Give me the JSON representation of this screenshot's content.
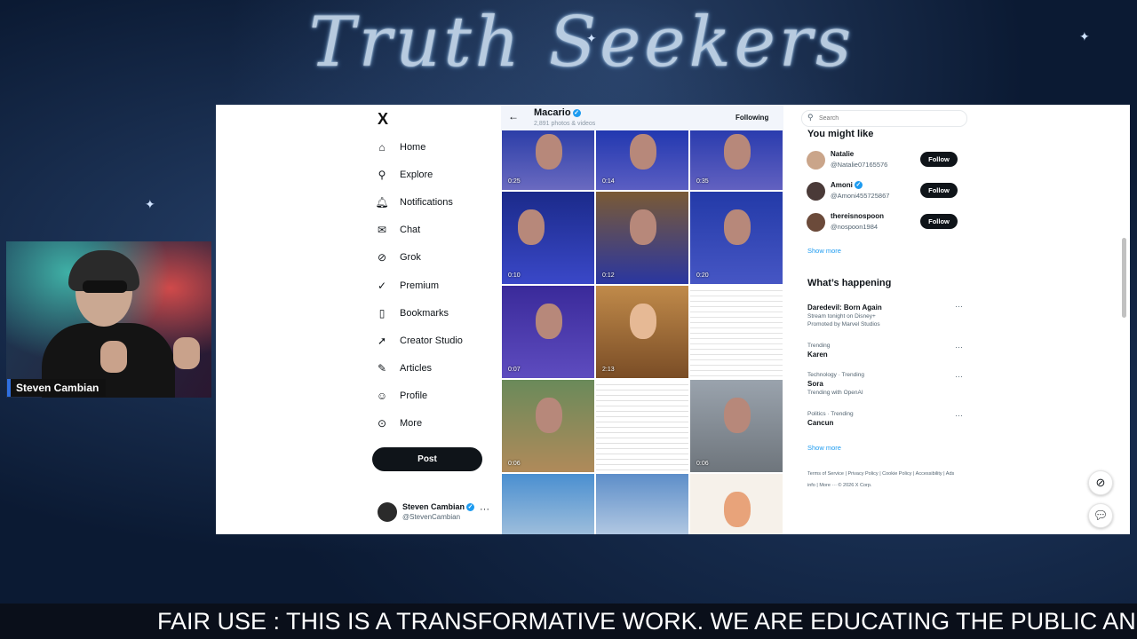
{
  "banner": {
    "title": "Truth Seekers"
  },
  "webcam": {
    "name": "Steven Cambian"
  },
  "ticker": {
    "text": "FAIR USE : THIS IS A TRANSFORMATIVE WORK. WE ARE EDUCATING THE PUBLIC AND C"
  },
  "x": {
    "logo": "X",
    "nav": [
      {
        "label": "Home",
        "icon": "home-icon"
      },
      {
        "label": "Explore",
        "icon": "search-icon"
      },
      {
        "label": "Notifications",
        "icon": "bell-icon"
      },
      {
        "label": "Chat",
        "icon": "mail-icon"
      },
      {
        "label": "Grok",
        "icon": "grok-icon"
      },
      {
        "label": "Premium",
        "icon": "premium-icon"
      },
      {
        "label": "Bookmarks",
        "icon": "bookmark-icon"
      },
      {
        "label": "Creator Studio",
        "icon": "rocket-icon"
      },
      {
        "label": "Articles",
        "icon": "article-icon"
      },
      {
        "label": "Profile",
        "icon": "person-icon"
      },
      {
        "label": "More",
        "icon": "more-circle-icon"
      }
    ],
    "post_label": "Post",
    "account": {
      "name": "Steven Cambian",
      "handle": "@StevenCambian"
    }
  },
  "profile": {
    "name": "Macario",
    "count": "2,891 photos & videos",
    "following_label": "Following"
  },
  "media": [
    {
      "duration": "0:25"
    },
    {
      "duration": "0:14"
    },
    {
      "duration": "0:35"
    },
    {
      "duration": "0:10"
    },
    {
      "duration": "0:12"
    },
    {
      "duration": "0:20"
    },
    {
      "duration": "0:07"
    },
    {
      "duration": "2:13"
    },
    {
      "duration": ""
    },
    {
      "duration": "0:06"
    },
    {
      "duration": ""
    },
    {
      "duration": "0:06"
    },
    {
      "duration": ""
    },
    {
      "duration": ""
    },
    {
      "duration": ""
    }
  ],
  "right": {
    "search_placeholder": "Search",
    "you_might_like": "You might like",
    "suggestions": [
      {
        "name": "Natalie",
        "handle": "@Natalie07165576",
        "follow": "Follow",
        "verified": false
      },
      {
        "name": "Amoni",
        "handle": "@Amoni455725867",
        "follow": "Follow",
        "verified": true
      },
      {
        "name": "thereisnospoon",
        "handle": "@nospoon1984",
        "follow": "Follow",
        "verified": false
      }
    ],
    "show_more": "Show more",
    "whats_happening": "What’s happening",
    "trends": [
      {
        "meta": "",
        "title": "Daredevil: Born Again",
        "sub": "Stream tonight on Disney+",
        "sub2": "Promoted by Marvel Studios"
      },
      {
        "meta": "Trending",
        "title": "Karen",
        "sub": "",
        "sub2": ""
      },
      {
        "meta": "Technology · Trending",
        "title": "Sora",
        "sub": "Trending with OpenAI",
        "sub2": ""
      },
      {
        "meta": "Politics · Trending",
        "title": "Cancun",
        "sub": "",
        "sub2": ""
      }
    ],
    "show_more_2": "Show more",
    "footer": "Terms of Service | Privacy Policy | Cookie Policy | Accessibility | Ads info | More ··· © 2026 X Corp."
  },
  "colors": {
    "accent": "#1d9bf0",
    "background": "#0b1a33"
  }
}
